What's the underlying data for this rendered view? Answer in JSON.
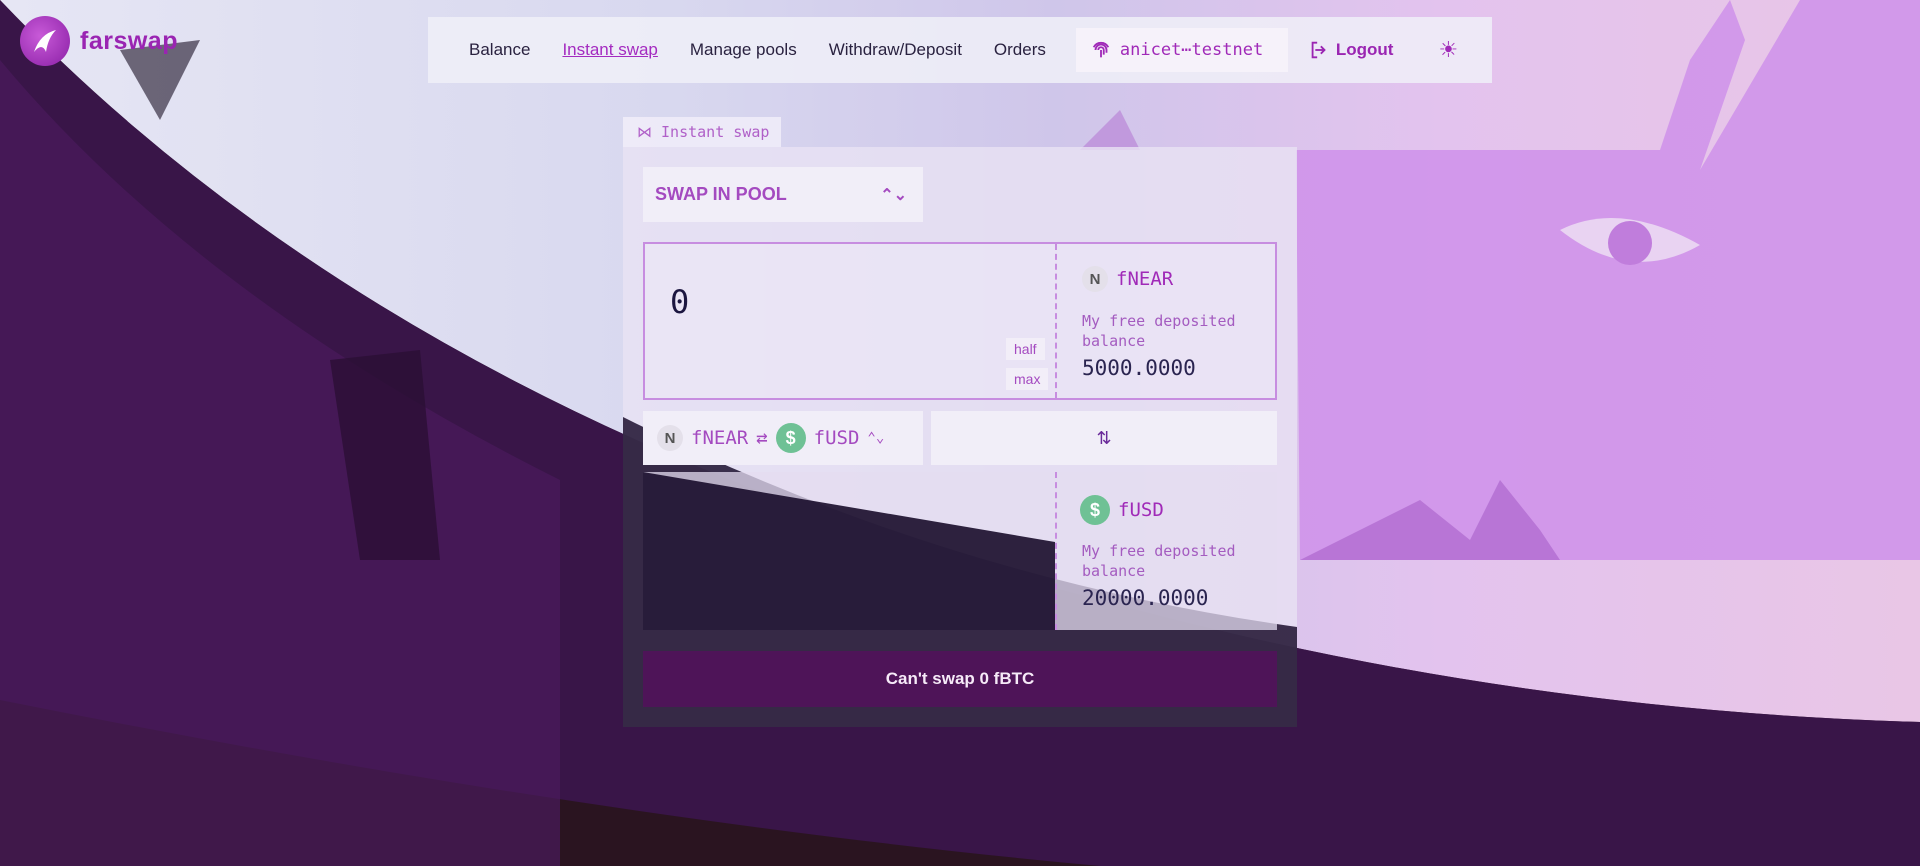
{
  "brand": {
    "name": "farswap"
  },
  "nav": {
    "items": [
      {
        "label": "Balance",
        "active": false
      },
      {
        "label": "Instant swap",
        "active": true
      },
      {
        "label": "Manage pools",
        "active": false
      },
      {
        "label": "Withdraw/Deposit",
        "active": false
      },
      {
        "label": "Orders",
        "active": false
      }
    ],
    "account": "anicet⋯testnet",
    "logout": "Logout",
    "theme_icon": "sun-icon"
  },
  "panel": {
    "tab_label": "⋈ Instant swap",
    "mode": "SWAP IN POOL",
    "from": {
      "amount": "0",
      "half_label": "half",
      "max_label": "max",
      "token": "fNEAR",
      "balance_label": "My free deposited balance",
      "balance": "5000.0000"
    },
    "pair": {
      "base": "fNEAR",
      "quote": "fUSD"
    },
    "to": {
      "token": "fUSD",
      "balance_label": "My free deposited balance",
      "balance": "20000.0000"
    },
    "swap_button": "Can't swap 0 fBTC"
  },
  "colors": {
    "accent": "#a02ab8",
    "button": "#4e1458",
    "usd_token": "#6fc195"
  }
}
